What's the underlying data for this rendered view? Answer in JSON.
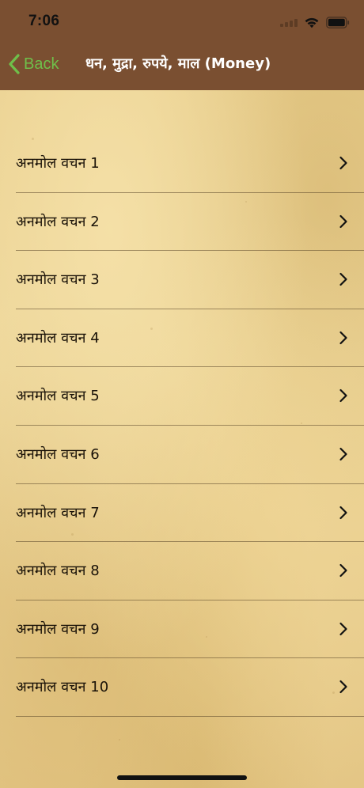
{
  "status_bar": {
    "time": "7:06"
  },
  "nav": {
    "back_label": "Back",
    "title": "धन, मुद्रा, रुपये, माल (Money)"
  },
  "list": {
    "items": [
      {
        "label": "अनमोल वचन 1"
      },
      {
        "label": "अनमोल वचन 2"
      },
      {
        "label": "अनमोल वचन 3"
      },
      {
        "label": "अनमोल वचन 4"
      },
      {
        "label": "अनमोल वचन 5"
      },
      {
        "label": "अनमोल वचन 6"
      },
      {
        "label": "अनमोल वचन 7"
      },
      {
        "label": "अनमोल वचन 8"
      },
      {
        "label": "अनमोल वचन 9"
      },
      {
        "label": "अनमोल वचन 10"
      }
    ]
  },
  "colors": {
    "header_background": "#7a4f31",
    "back_accent": "#6fbf4a",
    "title_text": "#ffffff",
    "parchment": "#e9cf8e",
    "row_text": "#1a1208"
  },
  "icons": {
    "back": "chevron-left-icon",
    "row_disclosure": "chevron-right-icon",
    "wifi": "wifi-icon",
    "battery": "battery-icon",
    "signal": "cellular-signal-icon"
  }
}
